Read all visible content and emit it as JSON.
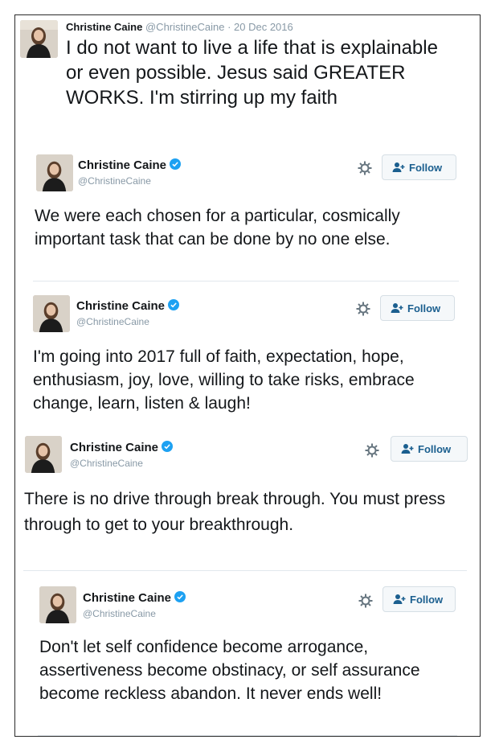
{
  "header": {
    "author": "Christine Caine",
    "handle": "@ChristineCaine",
    "date": "· 20 Dec 2016",
    "text": "I do not want to live a life that is explainable or even possible. Jesus said GREATER WORKS. I'm stirring up my faith"
  },
  "cards": [
    {
      "author": "Christine Caine",
      "handle": "@ChristineCaine",
      "follow_label": "Follow",
      "text": "We were each chosen for a particular, cosmically important task that can be done by no one else."
    },
    {
      "author": "Christine Caine",
      "handle": "@ChristineCaine",
      "follow_label": "Follow",
      "text": "I'm going into 2017 full of faith, expectation, hope, enthusiasm, joy, love, willing to take risks, embrace change, learn, listen & laugh!"
    },
    {
      "author": "Christine Caine",
      "handle": "@ChristineCaine",
      "follow_label": "Follow",
      "text": "There is no drive through break through. You must press through to get to your breakthrough."
    },
    {
      "author": "Christine Caine",
      "handle": "@ChristineCaine",
      "follow_label": "Follow",
      "text": "Don't let self confidence become arrogance, assertiveness become obstinacy, or self assurance become reckless abandon. It never ends well!"
    }
  ],
  "icons": {
    "verified": "verified-badge-icon",
    "settings": "gear-icon",
    "follow": "add-person-icon"
  },
  "colors": {
    "verified_blue": "#1da1f2",
    "handle_gray": "#8899a6",
    "follow_text": "#1b5f8f"
  }
}
